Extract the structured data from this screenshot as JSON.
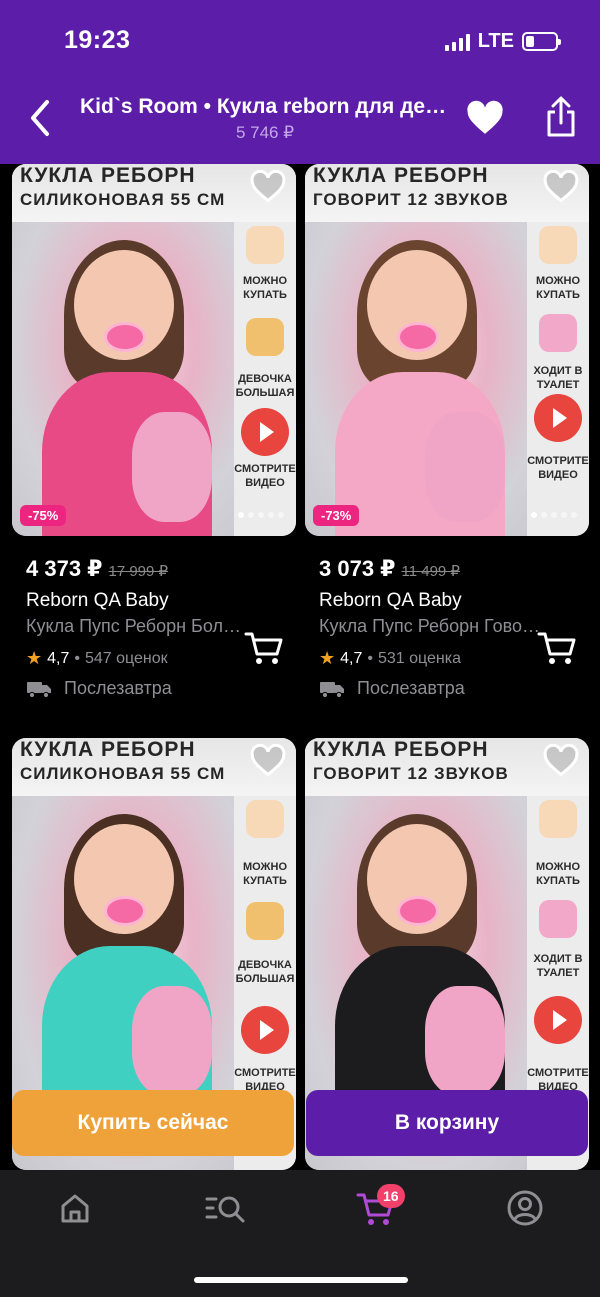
{
  "status": {
    "time": "19:23",
    "network": "LTE",
    "battery_level": 0.3
  },
  "header": {
    "title": "Kid`s Room • Кукла reborn для девочки",
    "price": "5 746 ₽"
  },
  "products": [
    {
      "banner_line1": "КУКЛА РЕБОРН",
      "banner_line2": "СИЛИКОНОВАЯ 55 СМ",
      "side_labels": [
        "МОЖНО КУПАТЬ",
        "ДЕВОЧКА БОЛЬШАЯ",
        "СМОТРИТЕ ВИДЕО"
      ],
      "discount": "-75%",
      "price": "4 373 ₽",
      "old_price": "17 999 ₽",
      "brand": "Reborn QA Baby",
      "name": "Кукла Пупс Реборн Большая",
      "rating": "4,7",
      "reviews": "547 оценок",
      "delivery": "Послезавтра",
      "body_color": "#e84a86",
      "hair_color": "#5a3a2a"
    },
    {
      "banner_line1": "КУКЛА РЕБОРН",
      "banner_line2": "ГОВОРИТ 12 ЗВУКОВ",
      "side_labels": [
        "МОЖНО КУПАТЬ",
        "ХОДИТ В ТУАЛЕТ",
        "СМОТРИТЕ ВИДЕО"
      ],
      "discount": "-73%",
      "price": "3 073 ₽",
      "old_price": "11 499 ₽",
      "brand": "Reborn QA Baby",
      "name": "Кукла Пупс Реборн Говорящая",
      "rating": "4,7",
      "reviews": "531 оценка",
      "delivery": "Послезавтра",
      "body_color": "#f4a8c6",
      "hair_color": "#6b4430"
    },
    {
      "banner_line1": "КУКЛА РЕБОРН",
      "banner_line2": "СИЛИКОНОВАЯ 55 СМ",
      "side_labels": [
        "МОЖНО КУПАТЬ",
        "ДЕВОЧКА БОЛЬШАЯ",
        "СМОТРИТЕ ВИДЕО"
      ],
      "body_color": "#3fd0c2",
      "hair_color": "#4b2f22"
    },
    {
      "banner_line1": "КУКЛА РЕБОРН",
      "banner_line2": "ГОВОРИТ 12 ЗВУКОВ",
      "side_labels": [
        "МОЖНО КУПАТЬ",
        "ХОДИТ В ТУАЛЕТ",
        "СМОТРИТЕ ВИДЕО"
      ],
      "body_color": "#1c1c1e",
      "hair_color": "#5a3a2a"
    }
  ],
  "actions": {
    "buy_now": "Купить сейчас",
    "add_to_cart": "В корзину"
  },
  "tabbar": {
    "items": [
      {
        "icon": "home-icon"
      },
      {
        "icon": "catalog-search-icon"
      },
      {
        "icon": "cart-icon",
        "badge": "16"
      },
      {
        "icon": "profile-icon"
      }
    ]
  },
  "colors": {
    "brand": "#5c1ea8",
    "buy": "#f0a23a",
    "discount": "#ec2680",
    "badge": "#f1416b"
  }
}
